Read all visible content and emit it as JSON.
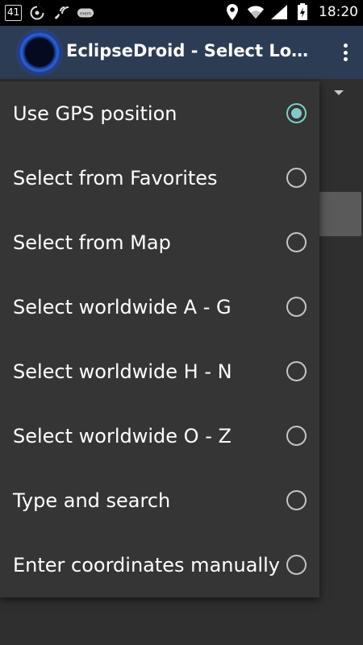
{
  "status_bar": {
    "notification_badge": "41",
    "time": "18:20",
    "icons": [
      "numbered-notification-icon",
      "sync-icon",
      "wifi-calling-icon",
      "voicemail-icon",
      "location-icon",
      "wifi-icon",
      "signal-icon",
      "battery-icon"
    ]
  },
  "action_bar": {
    "app_icon": "eclipse-icon",
    "title": "EclipseDroid - Select Location",
    "overflow_icon": "more-vert-icon"
  },
  "menu": {
    "items": [
      {
        "label": "Use GPS position",
        "checked": true
      },
      {
        "label": "Select from Favorites",
        "checked": false
      },
      {
        "label": "Select from Map",
        "checked": false
      },
      {
        "label": "Select worldwide A - G",
        "checked": false
      },
      {
        "label": "Select worldwide H - N",
        "checked": false
      },
      {
        "label": "Select worldwide O - Z",
        "checked": false
      },
      {
        "label": "Type and search",
        "checked": false
      },
      {
        "label": "Enter coordinates manually",
        "checked": false
      }
    ]
  },
  "colors": {
    "action_bar": "#2d3c55",
    "popup_bg": "#353535",
    "accent_radio": "#80cbc4",
    "background": "#2f2f2f"
  }
}
